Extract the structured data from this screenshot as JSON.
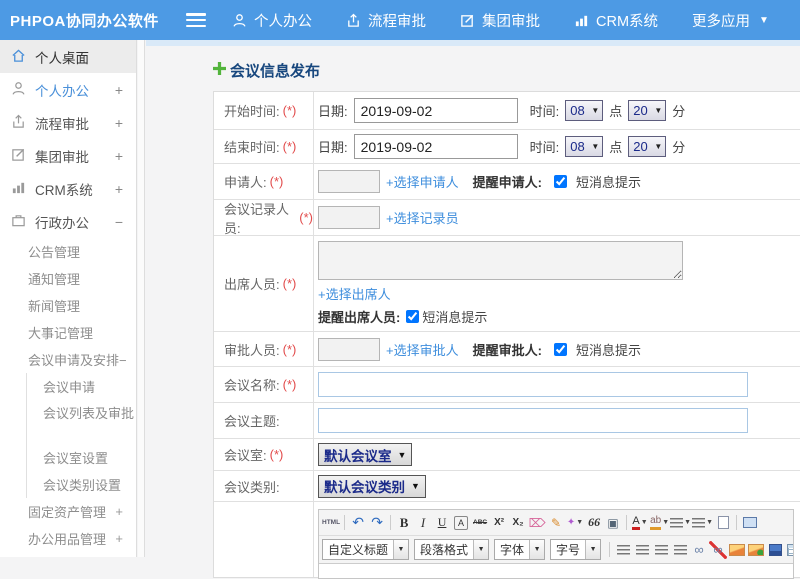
{
  "header": {
    "brand": "PHPOA协同办公软件",
    "nav": [
      {
        "label": "个人办公",
        "icon": "person-icon"
      },
      {
        "label": "流程审批",
        "icon": "workflow-icon"
      },
      {
        "label": "集团审批",
        "icon": "group-approval-icon"
      },
      {
        "label": "CRM系统",
        "icon": "crm-chart-icon"
      },
      {
        "label": "更多应用",
        "icon": "caret-down-icon"
      }
    ]
  },
  "sidebar": {
    "items": [
      {
        "label": "个人桌面",
        "icon": "home-icon",
        "active": true
      },
      {
        "label": "个人办公",
        "icon": "person-icon",
        "expand": "+"
      },
      {
        "label": "流程审批",
        "icon": "workflow-icon",
        "expand": "+"
      },
      {
        "label": "集团审批",
        "icon": "edit-icon",
        "expand": "+"
      },
      {
        "label": "CRM系统",
        "icon": "crm-chart-icon",
        "expand": "+"
      },
      {
        "label": "行政办公",
        "icon": "briefcase-icon",
        "expand": "−"
      }
    ],
    "admin_children": [
      {
        "label": "公告管理"
      },
      {
        "label": "通知管理"
      },
      {
        "label": "新闻管理"
      },
      {
        "label": "大事记管理"
      },
      {
        "label": "会议申请及安排−"
      }
    ],
    "meeting_children": [
      {
        "label": "会议申请"
      },
      {
        "label": "会议列表及审批"
      },
      {
        "label": "会议室设置"
      },
      {
        "label": "会议类别设置"
      }
    ],
    "more_items": [
      {
        "label": "固定资产管理",
        "expand": "+"
      },
      {
        "label": "办公用品管理",
        "expand": "+"
      }
    ]
  },
  "main": {
    "title": "会议信息发布",
    "title_icon": "green-plus-icon"
  },
  "form": {
    "start_time": {
      "label": "开始时间:",
      "required": "(*)",
      "date_label": "日期:",
      "date_value": "2019-09-02",
      "time_label": "时间:",
      "hour": "08",
      "hour_unit": "点",
      "minute": "20",
      "minute_unit": "分"
    },
    "end_time": {
      "label": "结束时间:",
      "required": "(*)",
      "date_label": "日期:",
      "date_value": "2019-09-02",
      "time_label": "时间:",
      "hour": "08",
      "hour_unit": "点",
      "minute": "20",
      "minute_unit": "分"
    },
    "applicant": {
      "label": "申请人:",
      "required": "(*)",
      "value": "",
      "link": "+选择申请人",
      "remind_label": "提醒申请人:",
      "sms_label": "短消息提示",
      "checked": true
    },
    "recorder": {
      "label": "会议记录人员:",
      "required": "(*)",
      "value": "",
      "link": "+选择记录员"
    },
    "attendees": {
      "label": "出席人员:",
      "required": "(*)",
      "value": "",
      "link": "+选择出席人",
      "remind_label": "提醒出席人员:",
      "sms_label": "短消息提示",
      "checked": true
    },
    "approver": {
      "label": "审批人员:",
      "required": "(*)",
      "value": "",
      "link": "+选择审批人",
      "remind_label": "提醒审批人:",
      "sms_label": "短消息提示",
      "checked": true
    },
    "meeting_name": {
      "label": "会议名称:",
      "required": "(*)",
      "value": ""
    },
    "meeting_topic": {
      "label": "会议主题:",
      "value": ""
    },
    "meeting_room": {
      "label": "会议室:",
      "required": "(*)",
      "value": "默认会议室"
    },
    "meeting_category": {
      "label": "会议类别:",
      "value": "默认会议类别"
    }
  },
  "editor": {
    "row1": [
      {
        "name": "html-source-icon",
        "glyph": "HTML"
      },
      {
        "name": "undo-icon",
        "glyph": "↶"
      },
      {
        "name": "redo-icon",
        "glyph": "↷"
      },
      {
        "name": "bold-icon",
        "glyph": "B"
      },
      {
        "name": "italic-icon",
        "glyph": "I"
      },
      {
        "name": "underline-icon",
        "glyph": "U"
      },
      {
        "name": "char-border-icon",
        "glyph": "A"
      },
      {
        "name": "strikethrough-icon",
        "glyph": "ABC"
      },
      {
        "name": "superscript-icon",
        "glyph": "X²"
      },
      {
        "name": "subscript-icon",
        "glyph": "X₂"
      },
      {
        "name": "eraser-icon",
        "glyph": "⌦"
      },
      {
        "name": "format-brush-icon",
        "glyph": "✎"
      },
      {
        "name": "auto-typeset-icon",
        "glyph": "✦"
      },
      {
        "name": "blockquote-icon",
        "glyph": "66"
      },
      {
        "name": "paste-as-text-icon",
        "glyph": "▣"
      },
      {
        "name": "font-color-icon",
        "glyph": "A"
      },
      {
        "name": "highlight-color-icon",
        "glyph": "ab"
      },
      {
        "name": "ordered-list-icon",
        "glyph": ""
      },
      {
        "name": "unordered-list-icon",
        "glyph": ""
      },
      {
        "name": "new-page-icon",
        "glyph": ""
      },
      {
        "name": "fullscreen-icon",
        "glyph": ""
      }
    ],
    "row2_selects": [
      {
        "name": "heading-select",
        "value": "自定义标题"
      },
      {
        "name": "paragraph-select",
        "value": "段落格式"
      },
      {
        "name": "font-family-select",
        "value": "字体"
      },
      {
        "name": "font-size-select",
        "value": "字号"
      }
    ],
    "row2_icons": [
      {
        "name": "align-left-icon"
      },
      {
        "name": "align-center-icon"
      },
      {
        "name": "align-right-icon"
      },
      {
        "name": "justify-icon"
      },
      {
        "name": "link-icon",
        "glyph": "∞"
      },
      {
        "name": "unlink-icon",
        "glyph": "∞"
      },
      {
        "name": "image-icon"
      },
      {
        "name": "image-upload-icon"
      },
      {
        "name": "media-icon"
      },
      {
        "name": "table-icon"
      }
    ]
  }
}
